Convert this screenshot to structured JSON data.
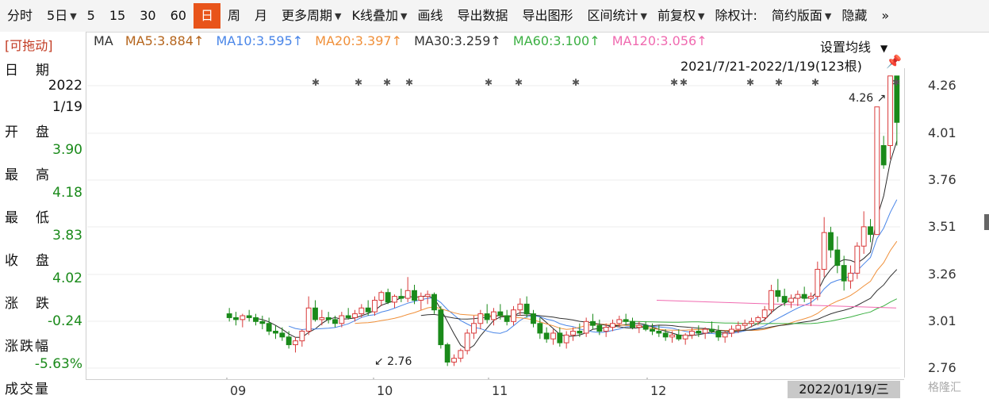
{
  "toolbar": {
    "items": [
      "分时",
      "5日",
      "5",
      "15",
      "30",
      "60",
      "日",
      "周",
      "月",
      "更多周期",
      "K线叠加",
      "画线",
      "导出数据",
      "导出图形",
      "区间统计",
      "前复权",
      "除权计:",
      "简约版面",
      "隐藏"
    ],
    "active_index": 6,
    "more_arrow": "»"
  },
  "left": {
    "drag_label": "[可拖动]",
    "date_label": "日期",
    "date_year": "2022",
    "date_md": "1/19",
    "open_label": "开盘",
    "open_value": "3.90",
    "high_label": "最高",
    "high_value": "4.18",
    "low_label": "最低",
    "low_value": "3.83",
    "close_label": "收盘",
    "close_value": "4.02",
    "change_label": "涨跌",
    "change_value": "-0.24",
    "pct_label": "涨跌幅",
    "pct_value": "-5.63%",
    "volume_label": "成交量"
  },
  "ma_header": {
    "prefix": "MA",
    "ma5": "MA5:3.884↑",
    "ma10": "MA10:3.595↑",
    "ma20": "MA20:3.397↑",
    "ma30": "MA30:3.259↑",
    "ma60": "MA60:3.100↑",
    "ma120": "MA120:3.056↑"
  },
  "setting_label": "设置均线",
  "range_label": "2021/7/21-2022/1/19(123根)",
  "cursor_date": "2022/01/19/三",
  "watermark": "格隆汇",
  "colors": {
    "up": "#d93b3b",
    "down": "#1a8a1a",
    "ma5": "#2b2b2b",
    "ma10": "#4a86e8",
    "ma20": "#f0903a",
    "ma30": "#333333",
    "ma60": "#3cb043",
    "ma120": "#f06ab0",
    "ma5_label": "#b5651d",
    "accent": "#e8541a"
  },
  "chart_data": {
    "type": "candlestick",
    "y_ticks": [
      "4.26",
      "4.01",
      "3.76",
      "3.51",
      "3.26",
      "3.01",
      "2.76"
    ],
    "ylim": [
      2.7,
      4.3
    ],
    "x_ticks": [
      "09",
      "10",
      "11",
      "12"
    ],
    "annotations": [
      {
        "text": "4.26",
        "value": 4.26
      },
      {
        "text": "2.76",
        "value": 2.76
      }
    ],
    "n_candles": 123,
    "candles_ohlc": [
      [
        3.03,
        3.06,
        2.99,
        3.01
      ],
      [
        3.01,
        3.04,
        2.97,
        3.0
      ],
      [
        3.0,
        3.03,
        2.96,
        3.02
      ],
      [
        3.02,
        3.05,
        2.99,
        3.01
      ],
      [
        3.01,
        3.03,
        2.97,
        2.99
      ],
      [
        2.99,
        3.02,
        2.95,
        2.98
      ],
      [
        2.98,
        3.01,
        2.92,
        2.94
      ],
      [
        2.94,
        2.97,
        2.9,
        2.93
      ],
      [
        2.93,
        2.96,
        2.89,
        2.91
      ],
      [
        2.91,
        2.94,
        2.85,
        2.87
      ],
      [
        2.87,
        2.91,
        2.83,
        2.89
      ],
      [
        2.89,
        2.95,
        2.86,
        2.94
      ],
      [
        2.94,
        3.12,
        2.92,
        3.06
      ],
      [
        3.06,
        3.1,
        2.99,
        3.0
      ],
      [
        3.0,
        3.05,
        2.97,
        3.01
      ],
      [
        3.01,
        3.04,
        2.98,
        3.0
      ],
      [
        3.0,
        3.02,
        2.96,
        2.98
      ],
      [
        2.98,
        3.04,
        2.96,
        3.02
      ],
      [
        3.02,
        3.06,
        3.0,
        3.01
      ],
      [
        3.01,
        3.05,
        2.99,
        3.03
      ],
      [
        3.03,
        3.08,
        3.01,
        3.06
      ],
      [
        3.06,
        3.1,
        3.02,
        3.04
      ],
      [
        3.04,
        3.12,
        3.02,
        3.1
      ],
      [
        3.1,
        3.15,
        3.07,
        3.14
      ],
      [
        3.14,
        3.16,
        3.08,
        3.09
      ],
      [
        3.09,
        3.13,
        3.06,
        3.12
      ],
      [
        3.12,
        3.16,
        3.09,
        3.11
      ],
      [
        3.11,
        3.22,
        3.09,
        3.15
      ],
      [
        3.15,
        3.18,
        3.08,
        3.1
      ],
      [
        3.1,
        3.14,
        3.05,
        3.12
      ],
      [
        3.12,
        3.15,
        3.08,
        3.13
      ],
      [
        3.13,
        3.14,
        3.03,
        3.05
      ],
      [
        3.05,
        3.07,
        2.85,
        2.87
      ],
      [
        2.87,
        2.88,
        2.76,
        2.78
      ],
      [
        2.78,
        2.82,
        2.76,
        2.8
      ],
      [
        2.8,
        2.85,
        2.78,
        2.84
      ],
      [
        2.84,
        2.95,
        2.82,
        2.93
      ],
      [
        2.93,
        3.02,
        2.9,
        2.98
      ],
      [
        2.98,
        3.05,
        2.95,
        3.03
      ],
      [
        3.03,
        3.08,
        2.98,
        3.0
      ],
      [
        3.0,
        3.06,
        2.97,
        3.04
      ],
      [
        3.04,
        3.08,
        3.0,
        3.02
      ],
      [
        3.02,
        3.05,
        2.97,
        2.99
      ],
      [
        2.99,
        3.07,
        2.97,
        3.05
      ],
      [
        3.05,
        3.11,
        3.02,
        3.08
      ],
      [
        3.08,
        3.12,
        3.01,
        3.03
      ],
      [
        3.03,
        3.05,
        2.96,
        2.98
      ],
      [
        2.98,
        3.01,
        2.9,
        2.93
      ],
      [
        2.93,
        2.96,
        2.88,
        2.9
      ],
      [
        2.9,
        2.95,
        2.87,
        2.93
      ],
      [
        2.93,
        2.96,
        2.86,
        2.88
      ],
      [
        2.88,
        2.94,
        2.85,
        2.92
      ],
      [
        2.92,
        2.96,
        2.89,
        2.94
      ],
      [
        2.94,
        2.98,
        2.91,
        2.93
      ],
      [
        2.93,
        3.01,
        2.91,
        2.99
      ],
      [
        2.99,
        3.03,
        2.95,
        2.97
      ],
      [
        2.97,
        3.0,
        2.92,
        2.94
      ],
      [
        2.94,
        2.98,
        2.91,
        2.96
      ],
      [
        2.96,
        3.0,
        2.94,
        2.98
      ],
      [
        2.98,
        3.02,
        2.96,
        3.0
      ],
      [
        3.0,
        3.03,
        2.97,
        2.99
      ],
      [
        2.99,
        3.01,
        2.95,
        2.96
      ],
      [
        2.96,
        2.99,
        2.93,
        2.97
      ],
      [
        2.97,
        2.99,
        2.94,
        2.95
      ],
      [
        2.95,
        2.98,
        2.92,
        2.94
      ],
      [
        2.94,
        2.97,
        2.91,
        2.93
      ],
      [
        2.93,
        2.95,
        2.89,
        2.91
      ],
      [
        2.91,
        2.94,
        2.88,
        2.92
      ],
      [
        2.92,
        2.95,
        2.89,
        2.9
      ],
      [
        2.9,
        2.93,
        2.87,
        2.92
      ],
      [
        2.92,
        2.96,
        2.9,
        2.94
      ],
      [
        2.94,
        2.97,
        2.91,
        2.93
      ],
      [
        2.93,
        2.96,
        2.9,
        2.95
      ],
      [
        2.95,
        2.99,
        2.93,
        2.94
      ],
      [
        2.94,
        2.97,
        2.89,
        2.91
      ],
      [
        2.91,
        2.94,
        2.88,
        2.93
      ],
      [
        2.93,
        2.97,
        2.91,
        2.95
      ],
      [
        2.95,
        2.99,
        2.93,
        2.97
      ],
      [
        2.97,
        3.0,
        2.95,
        2.98
      ],
      [
        2.98,
        3.01,
        2.96,
        2.99
      ],
      [
        2.99,
        3.02,
        2.97,
        3.01
      ],
      [
        3.01,
        3.07,
        2.99,
        3.05
      ],
      [
        3.05,
        3.18,
        3.03,
        3.15
      ],
      [
        3.15,
        3.21,
        3.09,
        3.12
      ],
      [
        3.12,
        3.16,
        3.07,
        3.09
      ],
      [
        3.09,
        3.13,
        3.06,
        3.11
      ],
      [
        3.11,
        3.15,
        3.07,
        3.13
      ],
      [
        3.13,
        3.17,
        3.09,
        3.11
      ],
      [
        3.11,
        3.14,
        3.07,
        3.12
      ],
      [
        3.12,
        3.3,
        3.1,
        3.26
      ],
      [
        3.26,
        3.53,
        3.22,
        3.45
      ],
      [
        3.45,
        3.48,
        3.32,
        3.36
      ],
      [
        3.36,
        3.43,
        3.24,
        3.28
      ],
      [
        3.28,
        3.33,
        3.15,
        3.2
      ],
      [
        3.2,
        3.28,
        3.16,
        3.24
      ],
      [
        3.24,
        3.4,
        3.21,
        3.38
      ],
      [
        3.38,
        3.56,
        3.34,
        3.48
      ],
      [
        3.48,
        3.52,
        3.4,
        3.44
      ],
      [
        3.44,
        4.1,
        3.7,
        4.1
      ],
      [
        3.9,
        3.95,
        3.78,
        3.8
      ],
      [
        3.9,
        4.26,
        3.83,
        4.26
      ],
      [
        4.26,
        4.26,
        3.9,
        4.02
      ]
    ]
  }
}
